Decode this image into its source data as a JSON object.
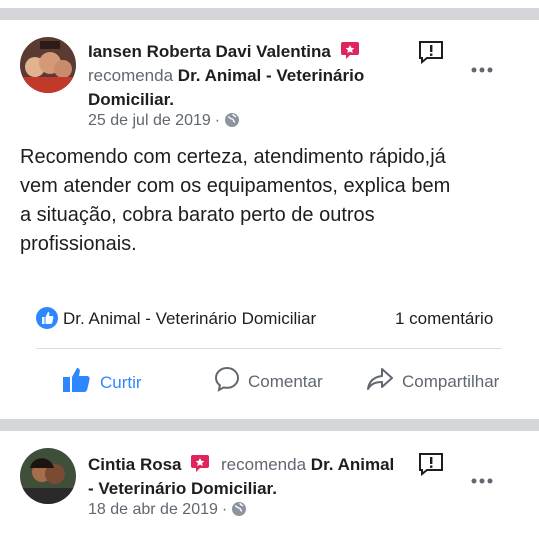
{
  "posts": [
    {
      "author": "Iansen Roberta Davi Valentina",
      "recommend_verb": "recomenda",
      "page_line1": "Dr. Animal - Veterinário",
      "page_line2": "Domiciliar.",
      "date": "25 de jul de 2019",
      "dot": "·",
      "text": [
        "Recomendo com certeza, atendimento rápido,já",
        "vem atender com os equipamentos, explica bem",
        "a situação, cobra barato perto de outros",
        "profissionais."
      ],
      "reactor": "Dr. Animal - Veterinário Domiciliar",
      "comments": "1 comentário",
      "actions": {
        "like": "Curtir",
        "comment": "Comentar",
        "share": "Compartilhar"
      }
    },
    {
      "author": "Cintia Rosa",
      "recommend_verb": "recomenda",
      "page_line1": "Dr. Animal",
      "page_line2": "- Veterinário Domiciliar.",
      "date": "18 de abr de 2019",
      "dot": "·"
    }
  ],
  "icons": {
    "recommend": "recommend-badge-icon",
    "report": "report-icon",
    "more": "more-options-icon",
    "globe": "globe-icon",
    "like_badge": "like-reaction-icon",
    "like": "thumbs-up-icon",
    "comment": "comment-icon",
    "share": "share-icon"
  },
  "colors": {
    "accent": "#2d88ff",
    "recommend": "#e0245e",
    "muted": "#606770",
    "separator": "#d4d6da"
  }
}
